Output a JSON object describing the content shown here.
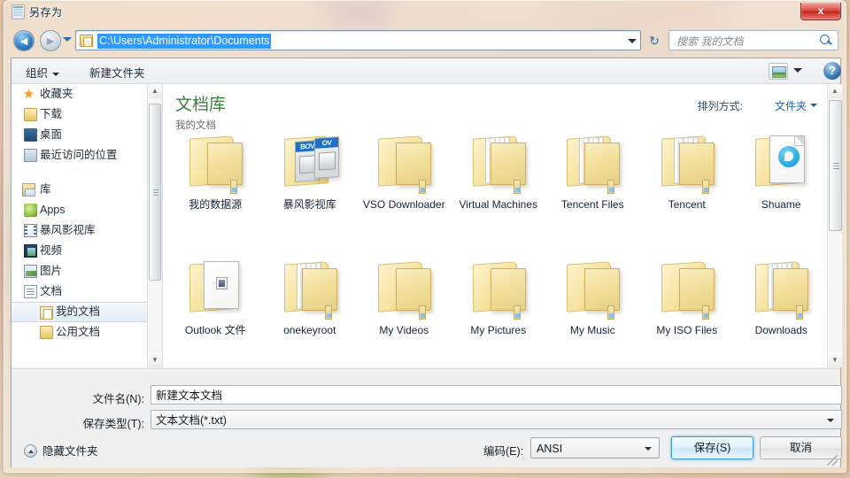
{
  "window": {
    "title": "另存为",
    "title_icon": "notepad-icon",
    "close_label": "x"
  },
  "navbar": {
    "back_icon": "back-arrow-icon",
    "back_glyph": "◄",
    "forward_icon": "forward-arrow-icon",
    "forward_glyph": "►",
    "address_path": "C:\\Users\\Administrator\\Documents",
    "refresh_icon": "refresh-icon",
    "refresh_glyph": "↻",
    "search_placeholder": "搜索 我的文档"
  },
  "toolbar": {
    "organize_label": "组织",
    "new_folder_label": "新建文件夹",
    "view_mode_icon": "view-mode-icon",
    "help_label": "?"
  },
  "sidebar": {
    "groups": [
      {
        "header": "收藏夹",
        "icon": "star-icon",
        "items": [
          {
            "label": "下载",
            "icon": "folder-icon",
            "selected": false,
            "nested": false
          },
          {
            "label": "桌面",
            "icon": "desktop-icon",
            "selected": false,
            "nested": false
          },
          {
            "label": "最近访问的位置",
            "icon": "recent-places-icon",
            "selected": false,
            "nested": false
          }
        ]
      },
      {
        "header": "库",
        "icon": "library-icon",
        "items": [
          {
            "label": "Apps",
            "icon": "apps-icon",
            "selected": false,
            "nested": false
          },
          {
            "label": "暴风影视库",
            "icon": "video-library-icon",
            "selected": false,
            "nested": false
          },
          {
            "label": "视频",
            "icon": "film-icon",
            "selected": false,
            "nested": false
          },
          {
            "label": "图片",
            "icon": "picture-icon",
            "selected": false,
            "nested": false
          },
          {
            "label": "文档",
            "icon": "document-icon",
            "selected": false,
            "nested": false
          },
          {
            "label": "我的文档",
            "icon": "my-documents-icon",
            "selected": true,
            "nested": true
          },
          {
            "label": "公用文档",
            "icon": "public-documents-icon",
            "selected": false,
            "nested": true
          }
        ]
      }
    ]
  },
  "content": {
    "library_title": "文档库",
    "library_subtitle": "我的文档",
    "arrange_label": "排列方式:",
    "arrange_value": "文件夹",
    "files": [
      {
        "label": "我的数据源",
        "icon": "folder-plain-icon"
      },
      {
        "label": "暴风影视库",
        "icon": "folder-baofeng-icon"
      },
      {
        "label": "VSO Downloader",
        "icon": "folder-plain-icon"
      },
      {
        "label": "Virtual Machines",
        "icon": "folder-with-files-icon"
      },
      {
        "label": "Tencent Files",
        "icon": "folder-with-files-icon"
      },
      {
        "label": "Tencent",
        "icon": "folder-with-files-icon"
      },
      {
        "label": "Shuame",
        "icon": "folder-shuame-icon"
      },
      {
        "label": "Outlook 文件",
        "icon": "folder-outlook-icon"
      },
      {
        "label": "onekeyroot",
        "icon": "folder-with-files-icon"
      },
      {
        "label": "My Videos",
        "icon": "folder-plain-icon"
      },
      {
        "label": "My Pictures",
        "icon": "folder-plain-icon"
      },
      {
        "label": "My Music",
        "icon": "folder-plain-icon"
      },
      {
        "label": "My ISO Files",
        "icon": "folder-plain-icon"
      },
      {
        "label": "Downloads",
        "icon": "folder-with-files-icon"
      }
    ]
  },
  "form": {
    "filename_label": "文件名(N):",
    "filename_value": "新建文本文档",
    "filetype_label": "保存类型(T):",
    "filetype_value": "文本文档(*.txt)",
    "hide_folders_label": "隐藏文件夹",
    "encoding_label": "编码(E):",
    "encoding_value": "ANSI",
    "save_label": "保存(S)",
    "cancel_label": "取消"
  },
  "colors": {
    "accent": "#3399ff",
    "library_green": "#3d7d3f",
    "link_blue": "#1d5fa6",
    "close_red": "#c1241c"
  }
}
